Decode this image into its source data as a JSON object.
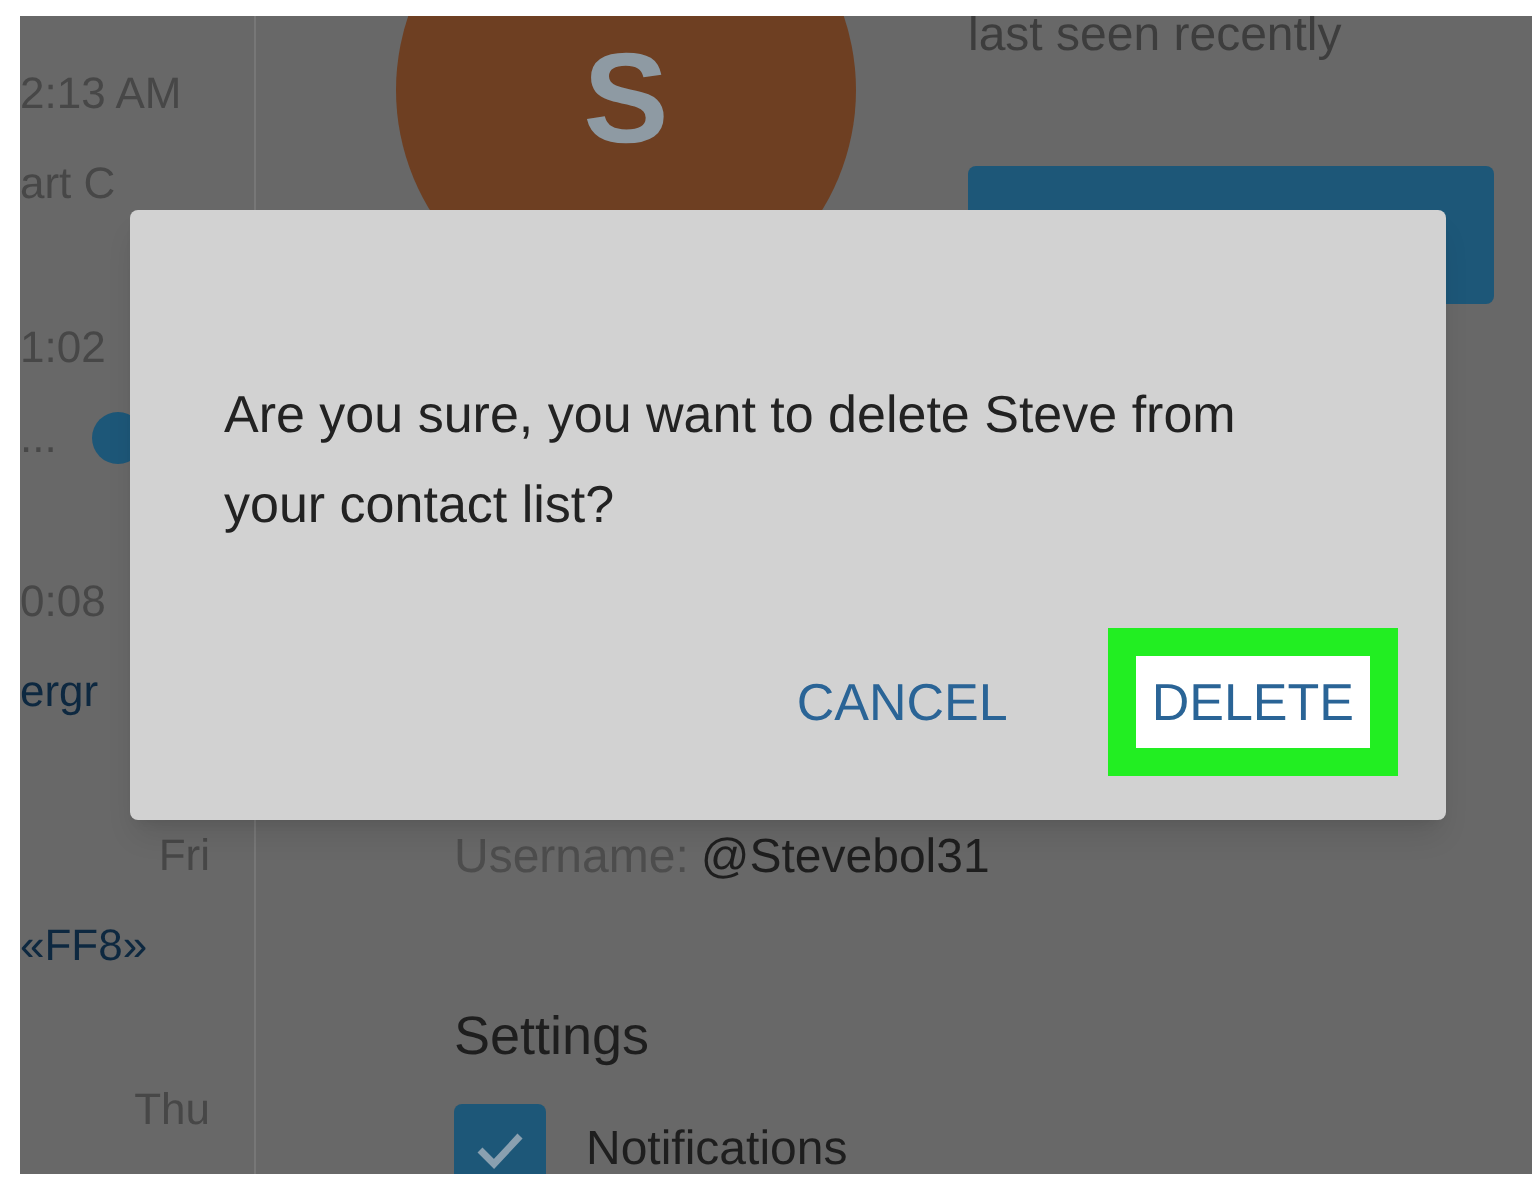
{
  "sidebar": {
    "chats": [
      {
        "time": "2:13 AM",
        "preview": "art C",
        "kind": "plain"
      },
      {
        "time": "1:02",
        "preview": "...",
        "kind": "plain",
        "unread": true
      },
      {
        "time": "0:08",
        "preview": "ergr",
        "kind": "link"
      },
      {
        "time": "Fri",
        "preview": "«FF8»",
        "kind": "link"
      },
      {
        "time": "Thu"
      }
    ]
  },
  "profile": {
    "avatar_letter": "S",
    "status": "last seen recently",
    "username_label": "Username:",
    "username": "@Stevebol31"
  },
  "settings": {
    "title": "Settings",
    "options": [
      {
        "label": "Notifications",
        "checked": true
      }
    ]
  },
  "dialog": {
    "message": "Are you sure, you want to delete Steve from your contact list?",
    "buttons": [
      {
        "label": "CANCEL",
        "highlighted": false
      },
      {
        "label": "DELETE",
        "highlighted": true
      }
    ]
  }
}
